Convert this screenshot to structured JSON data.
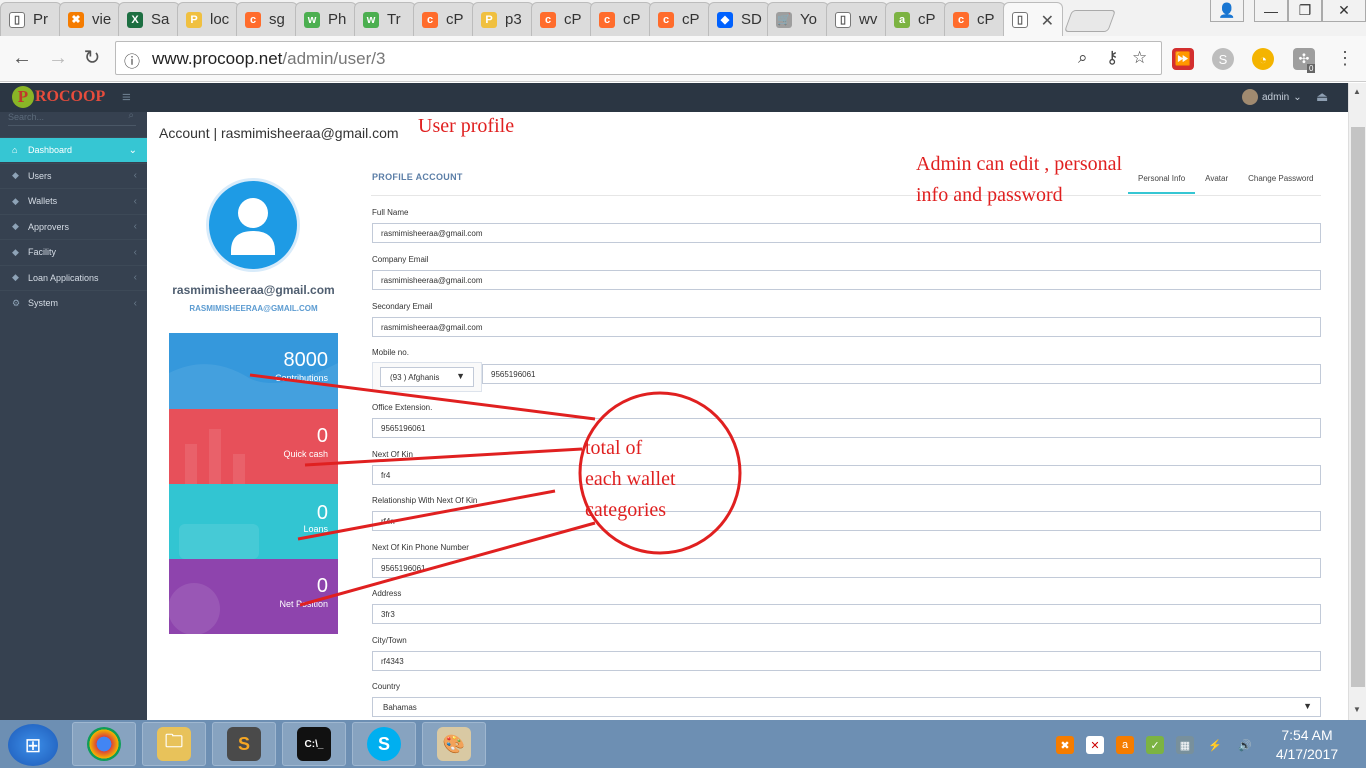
{
  "browser": {
    "tabs": [
      {
        "label": "Pr",
        "icon": "page-icon"
      },
      {
        "label": "vie",
        "icon": "xampp-icon"
      },
      {
        "label": "Sa",
        "icon": "excel-icon"
      },
      {
        "label": "loc",
        "icon": "phpmyadmin-icon"
      },
      {
        "label": "sg",
        "icon": "cpanel-icon"
      },
      {
        "label": "Ph",
        "icon": "green-w3-icon"
      },
      {
        "label": "Tr",
        "icon": "green-w3-icon"
      },
      {
        "label": "cP",
        "icon": "cpanel-icon"
      },
      {
        "label": "p3",
        "icon": "phpmyadmin-icon"
      },
      {
        "label": "cP",
        "icon": "cpanel-icon"
      },
      {
        "label": "cP",
        "icon": "cpanel-icon"
      },
      {
        "label": "cP",
        "icon": "cpanel-icon"
      },
      {
        "label": "SD",
        "icon": "dropbox-icon"
      },
      {
        "label": "Yo",
        "icon": "cart-icon"
      },
      {
        "label": "wv",
        "icon": "page-icon"
      },
      {
        "label": "cP",
        "icon": "green-a-icon"
      },
      {
        "label": "cP",
        "icon": "cpanel-icon"
      }
    ],
    "active_tab_close": "✕",
    "url_host": "www.procoop.net",
    "url_path": "/admin/user/3",
    "badge_count": "0"
  },
  "app": {
    "logo_letter": "P",
    "logo_text": "ROCOOP",
    "admin_label": "admin",
    "search_placeholder": "Search...",
    "sidebar": [
      {
        "label": "Dashboard",
        "active": true
      },
      {
        "label": "Users"
      },
      {
        "label": "Wallets"
      },
      {
        "label": "Approvers"
      },
      {
        "label": "Facility"
      },
      {
        "label": "Loan Applications"
      },
      {
        "label": "System"
      }
    ]
  },
  "breadcrumb": "Account | rasmimisheeraa@gmail.com",
  "profile": {
    "name": "rasmimisheeraa@gmail.com",
    "subname": "RASMIMISHEERAA@GMAIL.COM",
    "stats": [
      {
        "value": "8000",
        "label": "Contributions",
        "color": "#3598dc"
      },
      {
        "value": "0",
        "label": "Quick cash",
        "color": "#e7505a"
      },
      {
        "value": "0",
        "label": "Loans",
        "color": "#32c5d2"
      },
      {
        "value": "0",
        "label": "Net Position",
        "color": "#8e44ad"
      }
    ]
  },
  "form": {
    "title": "PROFILE ACCOUNT",
    "tabs": [
      "Personal Info",
      "Avatar",
      "Change Password"
    ],
    "full_name_label": "Full Name",
    "full_name": "rasmimisheeraa@gmail.com",
    "company_email_label": "Company Email",
    "company_email": "rasmimisheeraa@gmail.com",
    "secondary_email_label": "Secondary Email",
    "secondary_email": "rasmimisheeraa@gmail.com",
    "mobile_label": "Mobile no.",
    "country_code": "(93 ) Afghanis",
    "mobile": "9565196061",
    "office_ext_label": "Office Extension.",
    "office_ext": "9565196061",
    "kin_label": "Next Of Kin",
    "kin": "fr4",
    "kin_rel_label": "Relationship With Next Of Kin",
    "kin_rel": "rf4rr",
    "kin_phone_label": "Next Of Kin Phone Number",
    "kin_phone": "9565196061",
    "address_label": "Address",
    "address": "3fr3",
    "city_label": "City/Town",
    "city": "rf4343",
    "country_label": "Country",
    "country": "Bahamas"
  },
  "annotations": {
    "user_profile": "User profile",
    "admin_edit_1": "Admin can edit , personal",
    "admin_edit_2": "info and password",
    "circle_1": "total of",
    "circle_2": "each wallet",
    "circle_3": "categories"
  },
  "taskbar": {
    "time": "7:54 AM",
    "date": "4/17/2017"
  }
}
